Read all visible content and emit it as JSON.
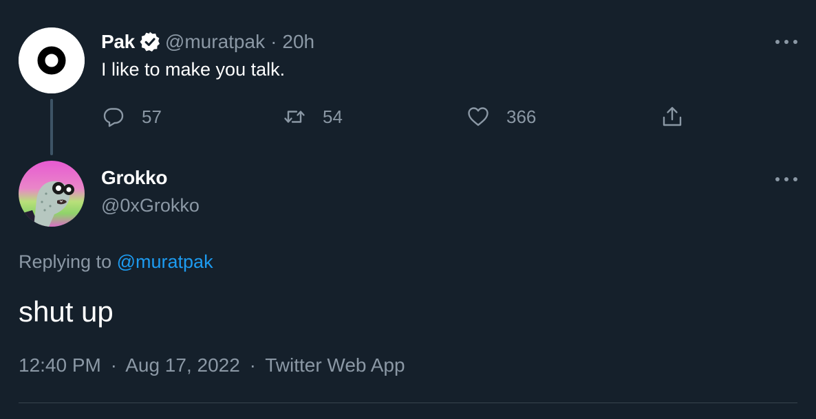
{
  "parent_tweet": {
    "author_name": "Pak",
    "author_handle": "@muratpak",
    "separator": "·",
    "time_ago": "20h",
    "text": "I like to make you talk.",
    "actions": {
      "reply_count": "57",
      "retweet_count": "54",
      "like_count": "366"
    }
  },
  "reply_tweet": {
    "author_name": "Grokko",
    "author_handle": "@0xGrokko",
    "replying_label": "Replying to",
    "replying_to": "@muratpak",
    "text": "shut up",
    "time": "12:40 PM",
    "date": "Aug 17, 2022",
    "source": "Twitter Web App",
    "separator": "·"
  },
  "icons": {
    "verified": "verified-badge-icon",
    "reply": "comment-icon",
    "retweet": "retweet-icon",
    "like": "heart-icon",
    "share": "share-upload-icon",
    "more": "more-dots-icon"
  },
  "colors": {
    "background": "#15202b",
    "text_primary": "#ffffff",
    "text_muted": "#8b98a5",
    "link": "#1d9bf0",
    "thread_line": "#3d5466",
    "divider": "#38444d"
  }
}
